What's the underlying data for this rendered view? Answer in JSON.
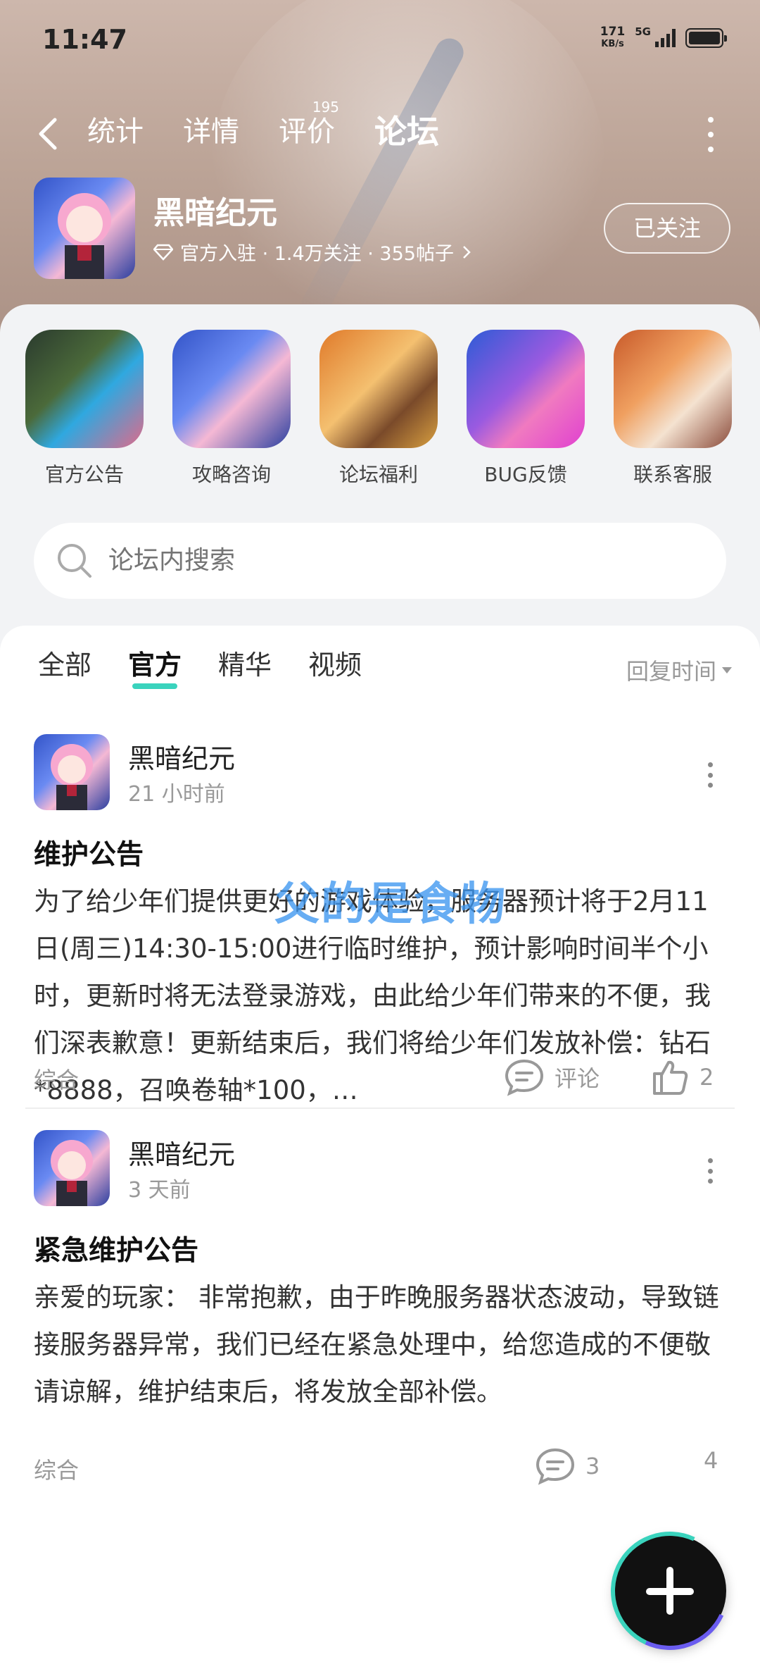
{
  "status_bar": {
    "time": "11:47",
    "net_speed_value": "171",
    "net_speed_unit": "KB/s",
    "network": "5G"
  },
  "nav": {
    "tabs": [
      {
        "label": "统计"
      },
      {
        "label": "详情"
      },
      {
        "label": "评价",
        "badge": "195"
      },
      {
        "label": "论坛",
        "active": true
      }
    ]
  },
  "game": {
    "name": "黑暗纪元",
    "meta": "官方入驻 · 1.4万关注 · 355帖子",
    "follow_label": "已关注"
  },
  "categories": [
    {
      "label": "官方公告"
    },
    {
      "label": "攻略咨询"
    },
    {
      "label": "论坛福利"
    },
    {
      "label": "BUG反馈"
    },
    {
      "label": "联系客服"
    }
  ],
  "search": {
    "placeholder": "论坛内搜索"
  },
  "feed": {
    "tabs": [
      {
        "label": "全部"
      },
      {
        "label": "官方",
        "active": true
      },
      {
        "label": "精华"
      },
      {
        "label": "视频"
      }
    ],
    "sort_label": "回复时间"
  },
  "posts": [
    {
      "author": "黑暗纪元",
      "time": "21 小时前",
      "title": "维护公告",
      "body": "为了给少年们提供更好的游戏体验，服务器预计将于2月11日(周三)14:30-15:00进行临时维护，预计影响时间半个小时，更新时将无法登录游戏，由此给少年们带来的不便，我们深表歉意！更新结束后，我们将给少年们发放补偿：钻石*8888，召唤卷轴*100，…",
      "tag": "综合",
      "comment_label": "评论",
      "likes": "2"
    },
    {
      "author": "黑暗纪元",
      "time": "3 天前",
      "title": "紧急维护公告",
      "body": "亲爱的玩家：  非常抱歉，由于昨晚服务器状态波动，导致链接服务器异常，我们已经在紧急处理中，给您造成的不便敬请谅解，维护结束后，将发放全部补偿。",
      "tag": "综合",
      "comments": "3",
      "likes": "4"
    }
  ],
  "watermark": "父的是食物",
  "colors": {
    "accent": "#3ad3bd",
    "watermark": "#3c96f0"
  }
}
